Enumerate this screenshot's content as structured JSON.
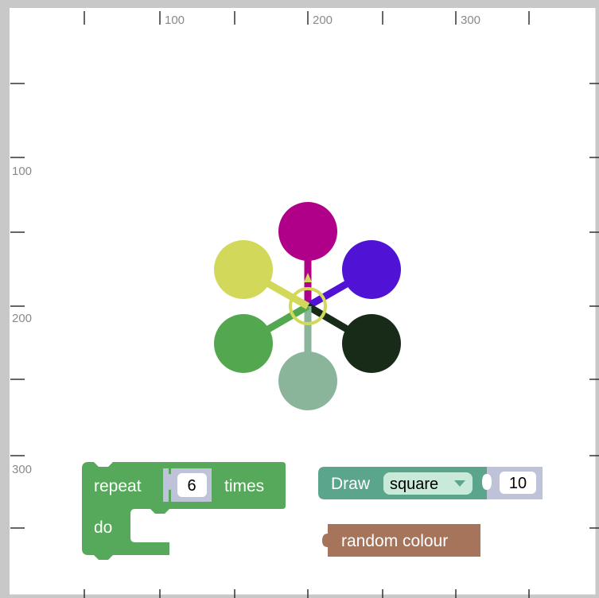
{
  "ruler": {
    "x_labels": [
      "100",
      "200",
      "300"
    ],
    "y_labels": [
      "100",
      "200",
      "300"
    ]
  },
  "drawing": {
    "petal_colors": [
      "#b0008a",
      "#5012d4",
      "#182a18",
      "#8bb59b",
      "#53a84f",
      "#d2d85a"
    ],
    "center_ring_color": "#d2d85a"
  },
  "blocks": {
    "repeat": {
      "label": "repeat",
      "count": "6",
      "suffix": "times",
      "do_label": "do",
      "color": "#56a85a"
    },
    "draw": {
      "label": "Draw",
      "shape": "square",
      "size": "10",
      "color": "#5ba58c"
    },
    "random_colour": {
      "label": "random colour",
      "color": "#a5745b"
    }
  }
}
